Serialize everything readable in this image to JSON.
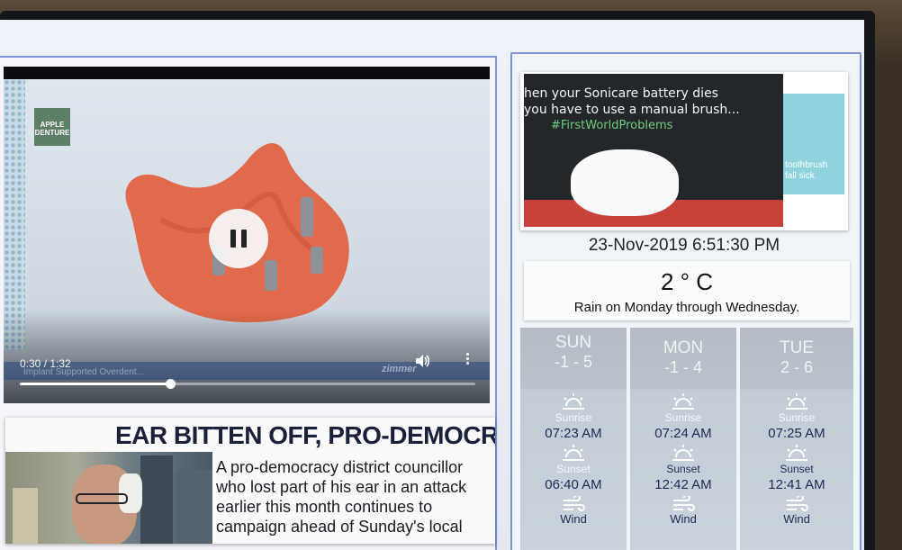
{
  "video": {
    "time": "0:30 / 1:32",
    "progress_fraction": 0.33,
    "logo_text": "APPLE DENTURE",
    "caption_text": "Implant Supported Overdent...",
    "brand_watermark": "zimmer"
  },
  "news": {
    "headline": "EAR BITTEN OFF, PRO-DEMOCR",
    "body": "A pro-democracy district councillor who lost part of his ear in an attack earlier this month continues to campaign ahead of Sunday's local"
  },
  "meme": {
    "line1": "hen your Sonicare battery dies",
    "line2": "you have to use a manual brush...",
    "hashtag": "#FirstWorldProblems",
    "side_line1": "toothbrush",
    "side_line2": "fall sick."
  },
  "datetime": "23-Nov-2019 6:51:30 PM",
  "weather": {
    "temperature": "2 ° C",
    "summary": "Rain on Monday through Wednesday."
  },
  "days": [
    {
      "name": "SUN",
      "range": "-1 - 5",
      "sunrise_label": "Sunrise",
      "sunrise": "07:23 AM",
      "sunset_label": "Sunset",
      "sunset": "06:40 AM",
      "wind_label": "Wind"
    },
    {
      "name": "MON",
      "range": "-1 - 4",
      "sunrise_label": "Sunrise",
      "sunrise": "07:24 AM",
      "sunset_label": "Sunset",
      "sunset": "12:42 AM",
      "wind_label": "Wind"
    },
    {
      "name": "TUE",
      "range": "2 - 6",
      "sunrise_label": "Sunrise",
      "sunrise": "07:25 AM",
      "sunset_label": "Sunset",
      "sunset": "12:41 AM",
      "wind_label": "Wind"
    }
  ],
  "colors": {
    "panel_border": "#7d95d6",
    "headline": "#1a1f3a",
    "time_text": "#1c2a56",
    "meme_hashtag": "#6fd07a"
  }
}
